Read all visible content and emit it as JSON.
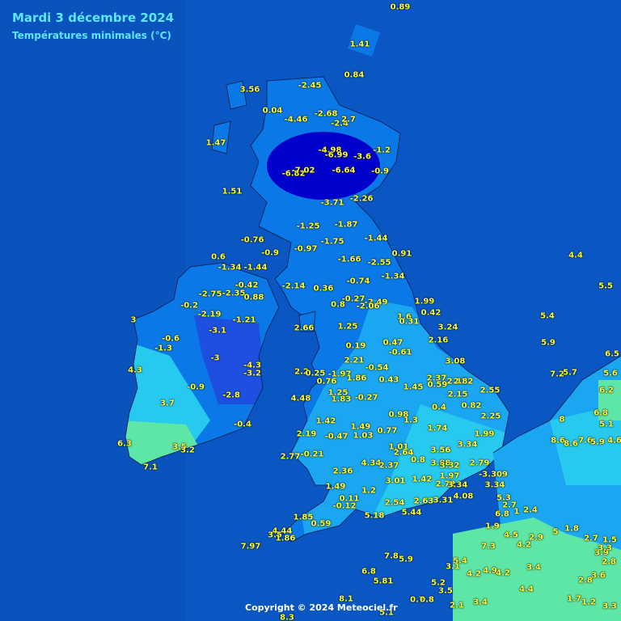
{
  "header": {
    "title": "Mardi 3 décembre 2024",
    "subtitle": "Températures minimales (°C)"
  },
  "footer": {
    "copyright": "Copyright © 2024 Meteociel.fr"
  },
  "colors": {
    "sea": "#0a57c4",
    "band_very_cold": "#0000cc",
    "band_cold": "#0a78e6",
    "band_cool": "#1aa6f0",
    "band_mild": "#27c9ee",
    "band_warm": "#5ee6a6",
    "label_text": "#ffff33"
  },
  "observations": [
    {
      "value": "0.89"
    },
    {
      "value": "1.41"
    },
    {
      "value": "0.84"
    },
    {
      "value": "3.56"
    },
    {
      "value": "-2.45"
    },
    {
      "value": "0.04"
    },
    {
      "value": "-4.46"
    },
    {
      "value": "-2.68"
    },
    {
      "value": "-2.4"
    },
    {
      "value": "2.7"
    },
    {
      "value": "1.47"
    },
    {
      "value": "-4.98"
    },
    {
      "value": "-6.99"
    },
    {
      "value": "-3.6"
    },
    {
      "value": "-1.2"
    },
    {
      "value": "-6.82"
    },
    {
      "value": "-7.02"
    },
    {
      "value": "-6.64"
    },
    {
      "value": "-0.9"
    },
    {
      "value": "1.51"
    },
    {
      "value": "-3.71"
    },
    {
      "value": "-2.26"
    },
    {
      "value": "-1.25"
    },
    {
      "value": "-1.87"
    },
    {
      "value": "-0.76"
    },
    {
      "value": "-1.75"
    },
    {
      "value": "-1.44"
    },
    {
      "value": "-0.97"
    },
    {
      "value": "-0.9"
    },
    {
      "value": "0.91"
    },
    {
      "value": "0.6"
    },
    {
      "value": "-1.66"
    },
    {
      "value": "-2.55"
    },
    {
      "value": "-1.34"
    },
    {
      "value": "-1.44"
    },
    {
      "value": "-1.34"
    },
    {
      "value": "-0.42"
    },
    {
      "value": "-2.14"
    },
    {
      "value": "0.36"
    },
    {
      "value": "-0.74"
    },
    {
      "value": "-2.75"
    },
    {
      "value": "-2.35"
    },
    {
      "value": "0.88"
    },
    {
      "value": "-0.2"
    },
    {
      "value": "0.8"
    },
    {
      "value": "-0.27"
    },
    {
      "value": "-2.49"
    },
    {
      "value": "-2.06"
    },
    {
      "value": "1.99"
    },
    {
      "value": "-2.19"
    },
    {
      "value": "-1.21"
    },
    {
      "value": "0.42"
    },
    {
      "value": "3"
    },
    {
      "value": "-3.1"
    },
    {
      "value": "2.66"
    },
    {
      "value": "1.25"
    },
    {
      "value": "1.6"
    },
    {
      "value": "0.31"
    },
    {
      "value": "3.24"
    },
    {
      "value": "-0.6"
    },
    {
      "value": "-1.3"
    },
    {
      "value": "0.19"
    },
    {
      "value": "0.47"
    },
    {
      "value": "-0.61"
    },
    {
      "value": "2.16"
    },
    {
      "value": "-3"
    },
    {
      "value": "2.21"
    },
    {
      "value": "-0.54"
    },
    {
      "value": "3.08"
    },
    {
      "value": "-4.3"
    },
    {
      "value": "-3.2"
    },
    {
      "value": "4.3"
    },
    {
      "value": "2.2"
    },
    {
      "value": "0.25"
    },
    {
      "value": "-1.97"
    },
    {
      "value": "0.76"
    },
    {
      "value": "1.86"
    },
    {
      "value": "0.43"
    },
    {
      "value": "2.37"
    },
    {
      "value": "0.59"
    },
    {
      "value": "2.42"
    },
    {
      "value": "2.82"
    },
    {
      "value": "-0.9"
    },
    {
      "value": "1.45"
    },
    {
      "value": "2.55"
    },
    {
      "value": "2.15"
    },
    {
      "value": "1.25"
    },
    {
      "value": "-2.8"
    },
    {
      "value": "4.48"
    },
    {
      "value": "1.83"
    },
    {
      "value": "-0.27"
    },
    {
      "value": "3.7"
    },
    {
      "value": "0.4"
    },
    {
      "value": "0.82"
    },
    {
      "value": "0.98"
    },
    {
      "value": "1.3"
    },
    {
      "value": "2.25"
    },
    {
      "value": "1.42"
    },
    {
      "value": "1.49"
    },
    {
      "value": "-0.4"
    },
    {
      "value": "0.77"
    },
    {
      "value": "1.74"
    },
    {
      "value": "2.19"
    },
    {
      "value": "-0.47"
    },
    {
      "value": "1.03"
    },
    {
      "value": "1.99"
    },
    {
      "value": "6.3"
    },
    {
      "value": "1.01"
    },
    {
      "value": "3.56"
    },
    {
      "value": "3.34"
    },
    {
      "value": "3.5"
    },
    {
      "value": "3.2"
    },
    {
      "value": "2.64"
    },
    {
      "value": "2.77"
    },
    {
      "value": "-0.21"
    },
    {
      "value": "4.34"
    },
    {
      "value": "2.37"
    },
    {
      "value": "0.8"
    },
    {
      "value": "3.88"
    },
    {
      "value": "3.32"
    },
    {
      "value": "2.79"
    },
    {
      "value": "7.1"
    },
    {
      "value": "2.36"
    },
    {
      "value": "1.97"
    },
    {
      "value": "-3.309"
    },
    {
      "value": "3.01"
    },
    {
      "value": "1.42"
    },
    {
      "value": "2.72"
    },
    {
      "value": "3.34"
    },
    {
      "value": "3.34"
    },
    {
      "value": "1.49"
    },
    {
      "value": "1.2"
    },
    {
      "value": "0.11"
    },
    {
      "value": "2.54"
    },
    {
      "value": "2.63"
    },
    {
      "value": "3.31"
    },
    {
      "value": "4.08"
    },
    {
      "value": "-0.12"
    },
    {
      "value": "5.44"
    },
    {
      "value": "1.85"
    },
    {
      "value": "5.18"
    },
    {
      "value": "0.59"
    },
    {
      "value": "4.44"
    },
    {
      "value": "3.5"
    },
    {
      "value": "1.86"
    },
    {
      "value": "7.97"
    },
    {
      "value": "4.4"
    },
    {
      "value": "5.5"
    },
    {
      "value": "5.4"
    },
    {
      "value": "5.9"
    },
    {
      "value": "6.5"
    },
    {
      "value": "7.2"
    },
    {
      "value": "5.7"
    },
    {
      "value": "5.6"
    },
    {
      "value": "6.2"
    },
    {
      "value": "6.8"
    },
    {
      "value": "5.1"
    },
    {
      "value": "8"
    },
    {
      "value": "8.6"
    },
    {
      "value": "8.6"
    },
    {
      "value": "7.6"
    },
    {
      "value": "5.9"
    },
    {
      "value": "4.6"
    },
    {
      "value": "7.8"
    },
    {
      "value": "5.9"
    },
    {
      "value": "6.8"
    },
    {
      "value": "5.81"
    },
    {
      "value": "5.4"
    },
    {
      "value": "3.1"
    },
    {
      "value": "7.3"
    },
    {
      "value": "4.9"
    },
    {
      "value": "4.2"
    },
    {
      "value": "5.2"
    },
    {
      "value": "4.2"
    },
    {
      "value": "2.8"
    },
    {
      "value": "3.5"
    },
    {
      "value": "1.7"
    },
    {
      "value": "1.2"
    },
    {
      "value": "2.1"
    },
    {
      "value": "3.4"
    },
    {
      "value": "0.7"
    },
    {
      "value": "0.8"
    },
    {
      "value": "3.3"
    },
    {
      "value": "8.1"
    },
    {
      "value": "8.3"
    },
    {
      "value": "5.1"
    },
    {
      "value": "3.6"
    },
    {
      "value": "2.8"
    },
    {
      "value": "1.9"
    },
    {
      "value": "4.5"
    },
    {
      "value": "2.9"
    },
    {
      "value": "4.2"
    },
    {
      "value": "3.4"
    },
    {
      "value": "4.4"
    },
    {
      "value": "5.3"
    },
    {
      "value": "6.8"
    },
    {
      "value": "2.7"
    },
    {
      "value": "2.4"
    },
    {
      "value": "1"
    },
    {
      "value": "5"
    },
    {
      "value": "1.8"
    },
    {
      "value": "3.9"
    },
    {
      "value": "3.3"
    },
    {
      "value": "2.7"
    },
    {
      "value": "1.5"
    }
  ]
}
